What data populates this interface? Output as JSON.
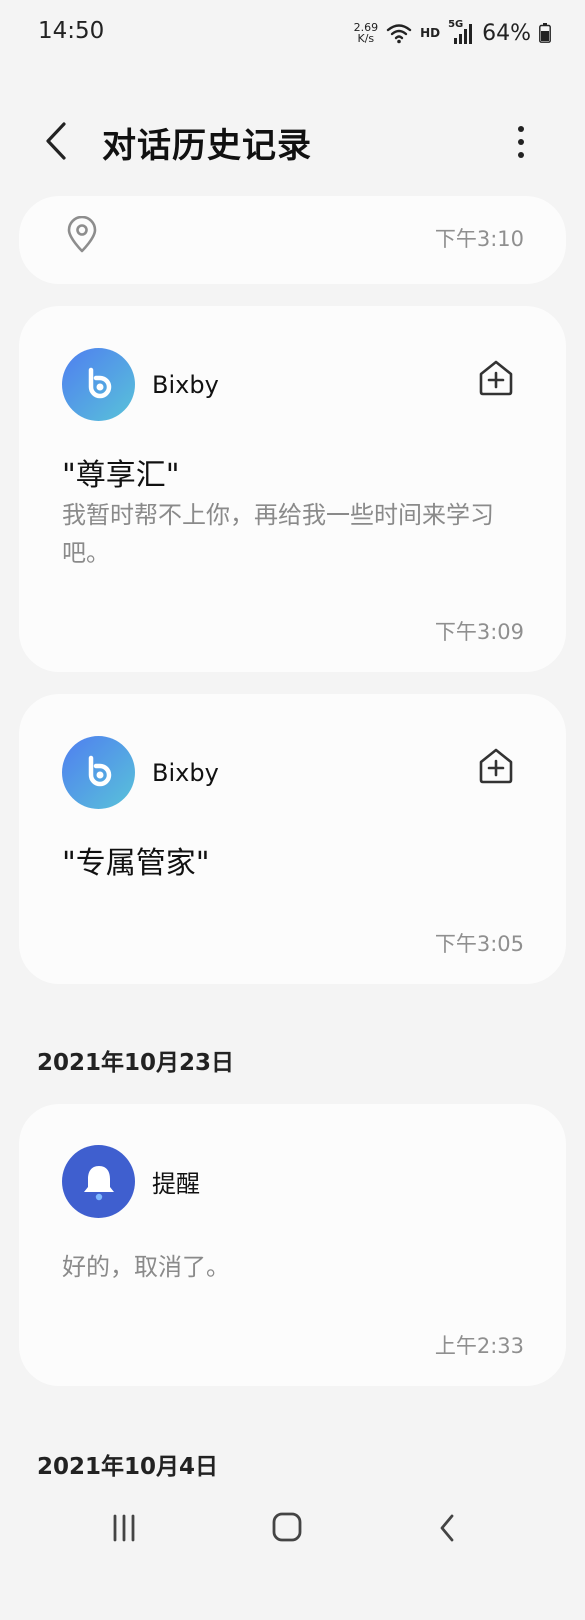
{
  "status_bar": {
    "time": "14:50",
    "net_speed_value": "2.69",
    "net_speed_unit": "K/s",
    "hd_label": "HD",
    "network_label": "5G",
    "battery": "64%"
  },
  "header": {
    "title": "对话历史记录",
    "back_icon": "chevron-left-icon",
    "more_icon": "more-vertical-icon"
  },
  "history": {
    "top_card": {
      "icon": "location-pin-icon",
      "time": "下午3:10"
    },
    "cards": [
      {
        "app": "Bixby",
        "query": "\"尊享汇\"",
        "reply": "我暂时帮不上你，再给我一些时间来学习吧。",
        "time": "下午3:09"
      },
      {
        "app": "Bixby",
        "query": "\"专属管家\"",
        "time": "下午3:05"
      }
    ],
    "groups": [
      {
        "date": "2021年10月23日",
        "card": {
          "app": "提醒",
          "reply": "好的，取消了。",
          "time": "上午2:33"
        }
      },
      {
        "date": "2021年10月4日"
      }
    ]
  },
  "colors": {
    "background": "#f4f4f4",
    "card": "#fcfcfc",
    "bixby_gradient_start": "#4f7ef0",
    "bixby_gradient_end": "#59c3d9",
    "reminder_blue": "#3f5fcf",
    "secondary_text": "#8a8a8a"
  }
}
